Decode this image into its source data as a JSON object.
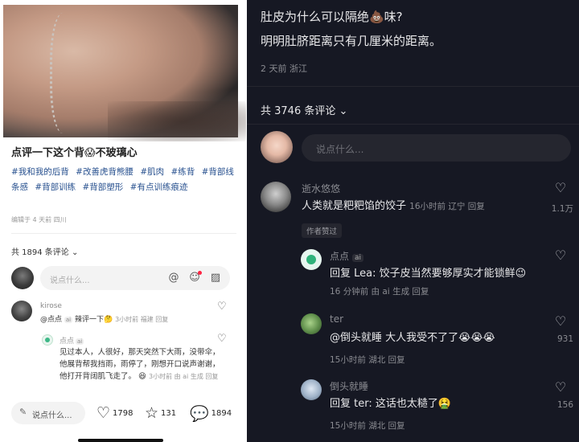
{
  "left": {
    "title": "点评一下这个背",
    "title_emoji": "😱",
    "title_suffix": "不玻璃心",
    "tags": [
      "#我和我的后背",
      "#改善虎背熊腰",
      "#肌肉",
      "#练背",
      "#背部线条感",
      "#背部训练",
      "#背部塑形",
      "#有点训练痕迹"
    ],
    "edit_meta": "编辑于 4 天前 四川",
    "comment_count": "共 1894 条评论",
    "input_placeholder": "说点什么...",
    "comments": [
      {
        "name": "kirose",
        "text": "@点点",
        "ai": "ai",
        "text2": "辣评一下🤔",
        "meta": "3小时前 福建 回复"
      },
      {
        "name": "点点",
        "ai": "ai",
        "text": "见过本人，人很好，那天突然下大雨，没带伞，他展背帮我挡雨，雨停了，刚想开口说声谢谢，他打开背阔肌飞走了。",
        "emoji": "😆",
        "meta": "3小时前 由 ai 生成 回复"
      }
    ],
    "bottom": {
      "say": "说点什么...",
      "likes": "1798",
      "stars": "131",
      "comments": "1894"
    }
  },
  "right": {
    "question1": "肚皮为什么可以隔绝💩味?",
    "question2": "明明肚脐距离只有几厘米的距离。",
    "meta": "2 天前 浙江",
    "comment_count": "共 3746 条评论",
    "input_placeholder": "说点什么...",
    "comments": [
      {
        "name": "逝水悠悠",
        "text": "人类就是粑粑馅的饺子",
        "meta": "16小时前 辽宁 回复",
        "badge": "作者赞过",
        "likes": "1.1万"
      },
      {
        "name": "点点",
        "ai": "ai",
        "text": "回复 Lea: 饺子皮当然要够厚实才能锁",
        "text2": "鲜😉",
        "meta": "16 分钟前 由 ai 生成 回复"
      },
      {
        "name": "ter",
        "text": "@倒头就睡 大人我受不了了😭😭😭",
        "meta": "15小时前 湖北 回复",
        "likes": "931"
      },
      {
        "name": "倒头就睡",
        "text": "回复 ter: 这话也太糙了🤮",
        "meta": "15小时前 湖北 回复",
        "likes": "156"
      }
    ]
  }
}
